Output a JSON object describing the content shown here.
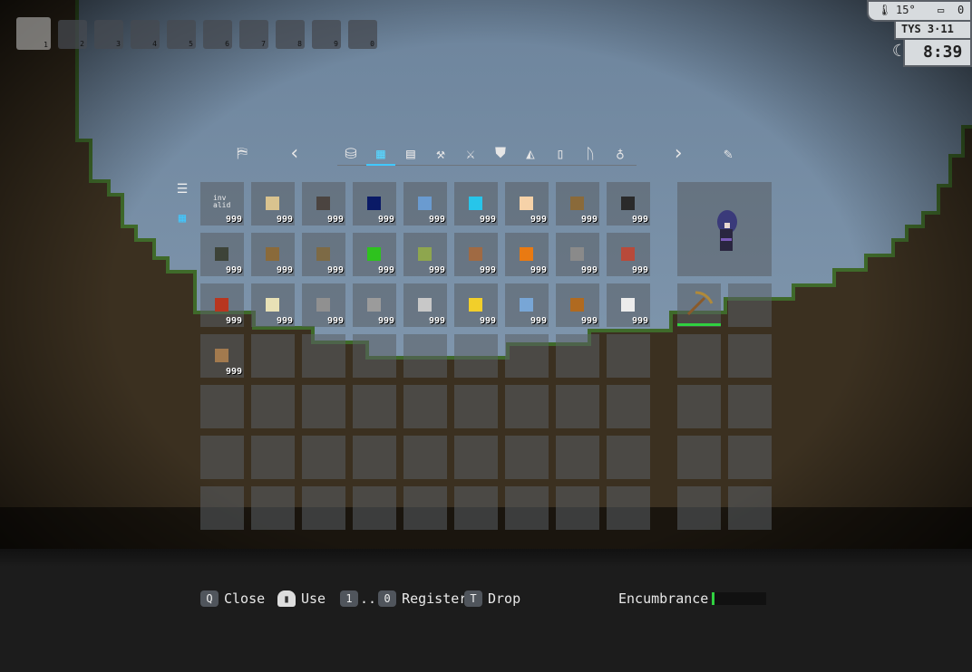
{
  "hotbar": {
    "slots": [
      "1",
      "2",
      "3",
      "4",
      "5",
      "6",
      "7",
      "8",
      "9",
      "0"
    ],
    "active_index": 0
  },
  "hud": {
    "temperature": "15°",
    "battery": "0",
    "date": "TYS 3·11",
    "time": "8:39"
  },
  "tabs": {
    "left_icon": "map-icon",
    "prev": "‹",
    "next": "›",
    "right_icon": "notebook-icon",
    "items": [
      {
        "icon": "backpack-icon",
        "glyph": "⛁"
      },
      {
        "icon": "blocks-icon",
        "glyph": "▦",
        "active": true
      },
      {
        "icon": "wall-icon",
        "glyph": "▤"
      },
      {
        "icon": "hammer-icon",
        "glyph": "⚒"
      },
      {
        "icon": "swords-icon",
        "glyph": "⚔"
      },
      {
        "icon": "armor-icon",
        "glyph": "⛊"
      },
      {
        "icon": "paint-bucket-icon",
        "glyph": "◭"
      },
      {
        "icon": "jar-icon",
        "glyph": "▯"
      },
      {
        "icon": "runes-icon",
        "glyph": "ᚢ"
      },
      {
        "icon": "sack-icon",
        "glyph": "♁"
      }
    ]
  },
  "side_tools": {
    "list_glyph": "☰",
    "grid_glyph": "▦"
  },
  "inventory": {
    "count_label": "999",
    "items": [
      {
        "kind": "invalid",
        "label": "inv alid"
      },
      {
        "color": "#d9c38f"
      },
      {
        "color": "#4b4440"
      },
      {
        "color": "#0a1a66"
      },
      {
        "color": "#6a9bd0"
      },
      {
        "color": "#27c5ea"
      },
      {
        "color": "#f6d2a8"
      },
      {
        "color": "#8a6a3a"
      },
      {
        "color": "#2a2a2a"
      },
      {
        "color": "#3d4338"
      },
      {
        "color": "#8a6a3a"
      },
      {
        "color": "#7d6a45"
      },
      {
        "color": "#2ec21e"
      },
      {
        "color": "#8ea64e"
      },
      {
        "color": "#a06a43"
      },
      {
        "color": "#e97a12"
      },
      {
        "color": "#8a8a8a"
      },
      {
        "color": "#b84a3a"
      },
      {
        "color": "#b8361f"
      },
      {
        "color": "#e8e1b6"
      },
      {
        "color": "#909090"
      },
      {
        "color": "#9b9b9b"
      },
      {
        "color": "#c8c8c8"
      },
      {
        "color": "#f2cf2a"
      },
      {
        "color": "#78a6d6"
      },
      {
        "color": "#b06a20"
      },
      {
        "color": "#ececec"
      },
      {
        "color": "#a27a4e"
      }
    ],
    "total_slots": 63
  },
  "equipment": {
    "tool_icon": "pickaxe-icon",
    "hp_fraction": 1.0
  },
  "footer": {
    "close": {
      "key": "Q",
      "label": "Close"
    },
    "use": {
      "key": "▮",
      "label": "Use"
    },
    "register": {
      "key_a": "1",
      "sep": "..",
      "key_b": "0",
      "label": "Register"
    },
    "drop": {
      "key": "T",
      "label": "Drop"
    },
    "encumbrance": {
      "label": "Encumbrance",
      "fraction": 0.02
    }
  },
  "colors": {
    "accent": "#40c8ff",
    "health": "#30d040",
    "sky": "#7e95ad",
    "dirt": "#3f3322"
  }
}
